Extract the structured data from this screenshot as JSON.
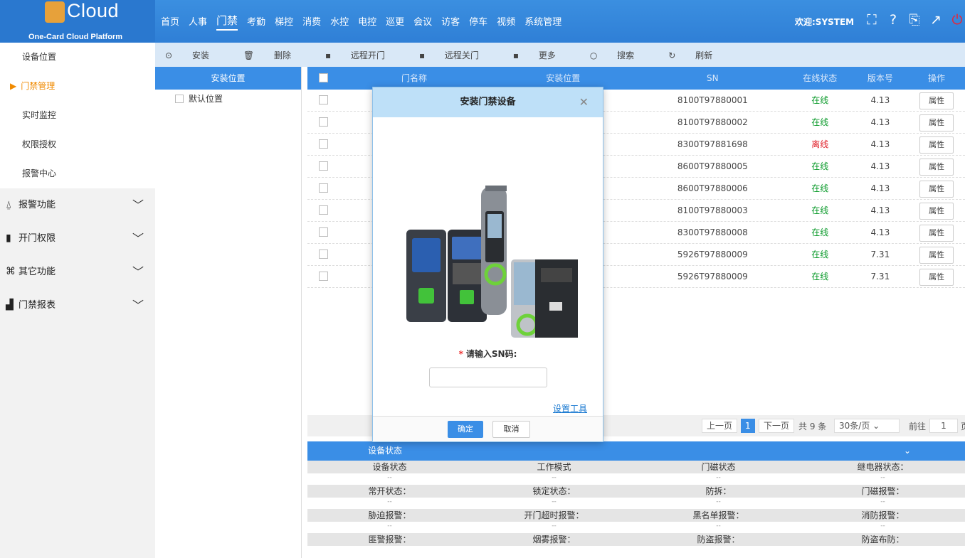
{
  "app": {
    "logo_text": "Cloud",
    "logo_sub": "One-Card Cloud Platform",
    "welcome": "欢迎:SYSTEM"
  },
  "topnav": [
    "首页",
    "人事",
    "门禁",
    "考勤",
    "梯控",
    "消费",
    "水控",
    "电控",
    "巡更",
    "会议",
    "访客",
    "停车",
    "视频",
    "系统管理"
  ],
  "topnav_active": "门禁",
  "top_icons": [
    "fullscreen-icon",
    "help-icon",
    "language-icon",
    "edit-window-icon",
    "power-icon"
  ],
  "sidebar": {
    "sub_items": [
      "设备位置",
      "门禁管理",
      "实时监控",
      "权限授权",
      "报警中心"
    ],
    "active_sub": "门禁管理",
    "groups": [
      {
        "label": "报警功能",
        "icon": "alarm-icon"
      },
      {
        "label": "开门权限",
        "icon": "door-icon"
      },
      {
        "label": "其它功能",
        "icon": "command-icon"
      },
      {
        "label": "门禁报表",
        "icon": "chart-icon"
      }
    ]
  },
  "toolbar": {
    "install": "安装",
    "delete": "删除",
    "remote_open": "远程开门",
    "remote_close": "远程关门",
    "more": "更多",
    "search": "搜索",
    "refresh": "刷新"
  },
  "tree": {
    "header": "安装位置",
    "items": [
      "默认位置"
    ]
  },
  "table": {
    "columns": [
      "门名称",
      "安装位置",
      "SN",
      "在线状态",
      "版本号",
      "操作"
    ],
    "rows": [
      {
        "sn": "8100T97880001",
        "status": "在线",
        "online": true,
        "version": "4.13",
        "action": "属性"
      },
      {
        "sn": "8100T97880002",
        "status": "在线",
        "online": true,
        "version": "4.13",
        "action": "属性"
      },
      {
        "sn": "8300T97881698",
        "status": "离线",
        "online": false,
        "version": "4.13",
        "action": "属性"
      },
      {
        "sn": "8600T97880005",
        "status": "在线",
        "online": true,
        "version": "4.13",
        "action": "属性"
      },
      {
        "sn": "8600T97880006",
        "status": "在线",
        "online": true,
        "version": "4.13",
        "action": "属性"
      },
      {
        "sn": "8100T97880003",
        "status": "在线",
        "online": true,
        "version": "4.13",
        "action": "属性"
      },
      {
        "sn": "8300T97880008",
        "status": "在线",
        "online": true,
        "version": "4.13",
        "action": "属性"
      },
      {
        "sn": "5926T97880009",
        "status": "在线",
        "online": true,
        "version": "7.31",
        "action": "属性"
      },
      {
        "sn": "5926T97880009",
        "status": "在线",
        "online": true,
        "version": "7.31",
        "action": "属性"
      }
    ]
  },
  "pager": {
    "prev": "上一页",
    "current": "1",
    "next": "下一页",
    "total": "共 9 条",
    "page_size": "30条/页",
    "goto": "前往",
    "goto_value": "1",
    "page_suffix": "页"
  },
  "status_panel": {
    "title": "设备状态",
    "labels": [
      [
        "设备状态",
        "工作模式",
        "门磁状态",
        "继电器状态："
      ],
      [
        "常开状态：",
        "锁定状态：",
        "防拆：",
        "门磁报警："
      ],
      [
        "胁迫报警：",
        "开门超时报警：",
        "黑名单报警：",
        "消防报警："
      ],
      [
        "匪警报警：",
        "烟雾报警：",
        "防盗报警：",
        "防盗布防："
      ]
    ],
    "placeholder": "--"
  },
  "modal": {
    "title": "安装门禁设备",
    "sn_label": "请输入SN码:",
    "sn_value": "",
    "tool_link": "设置工具",
    "ok": "确定",
    "cancel": "取消"
  },
  "colors": {
    "primary": "#3a8ee6",
    "online": "#0a9a2a",
    "offline": "#e0202a",
    "active_menu": "#f08a00"
  }
}
